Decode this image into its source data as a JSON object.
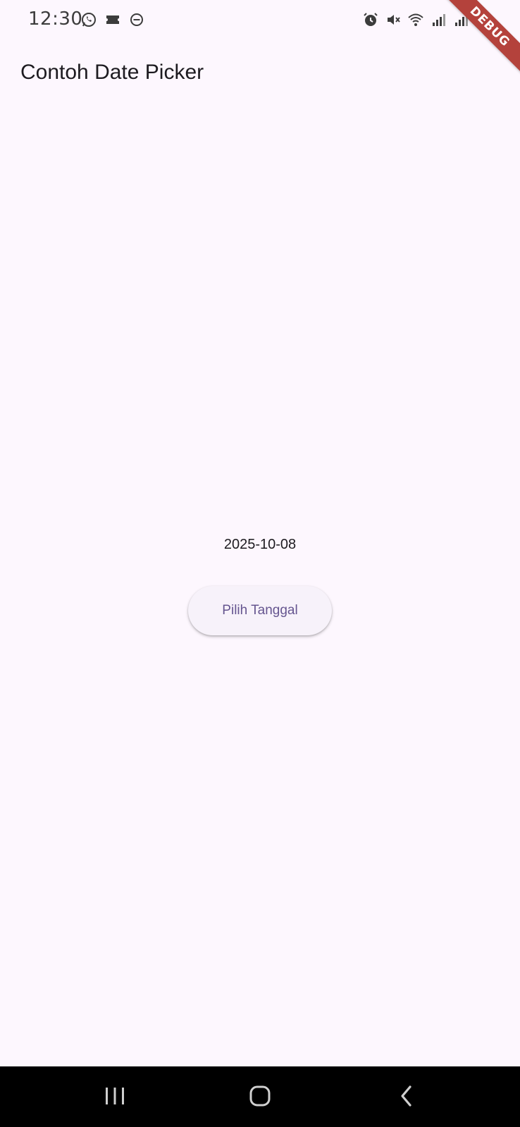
{
  "status_bar": {
    "time": "12:30",
    "left_icons": [
      "whatsapp-icon",
      "ticket-icon",
      "do-not-disturb-icon"
    ],
    "right_icons": [
      "alarm-icon",
      "mute-icon",
      "wifi-icon",
      "signal-icon",
      "signal-icon",
      "battery-icon"
    ]
  },
  "debug_banner": {
    "label": "DEBUG",
    "color": "#b4423c"
  },
  "app_bar": {
    "title": "Contoh Date Picker"
  },
  "main": {
    "selected_date": "2025-10-08",
    "pick_button_label": "Pilih Tanggal"
  },
  "nav_bar": {
    "buttons": [
      "recent-apps-icon",
      "home-icon",
      "back-icon"
    ]
  },
  "colors": {
    "background": "#fdf7fe",
    "button_text": "#65558f",
    "button_bg": "#f7f2fa"
  }
}
